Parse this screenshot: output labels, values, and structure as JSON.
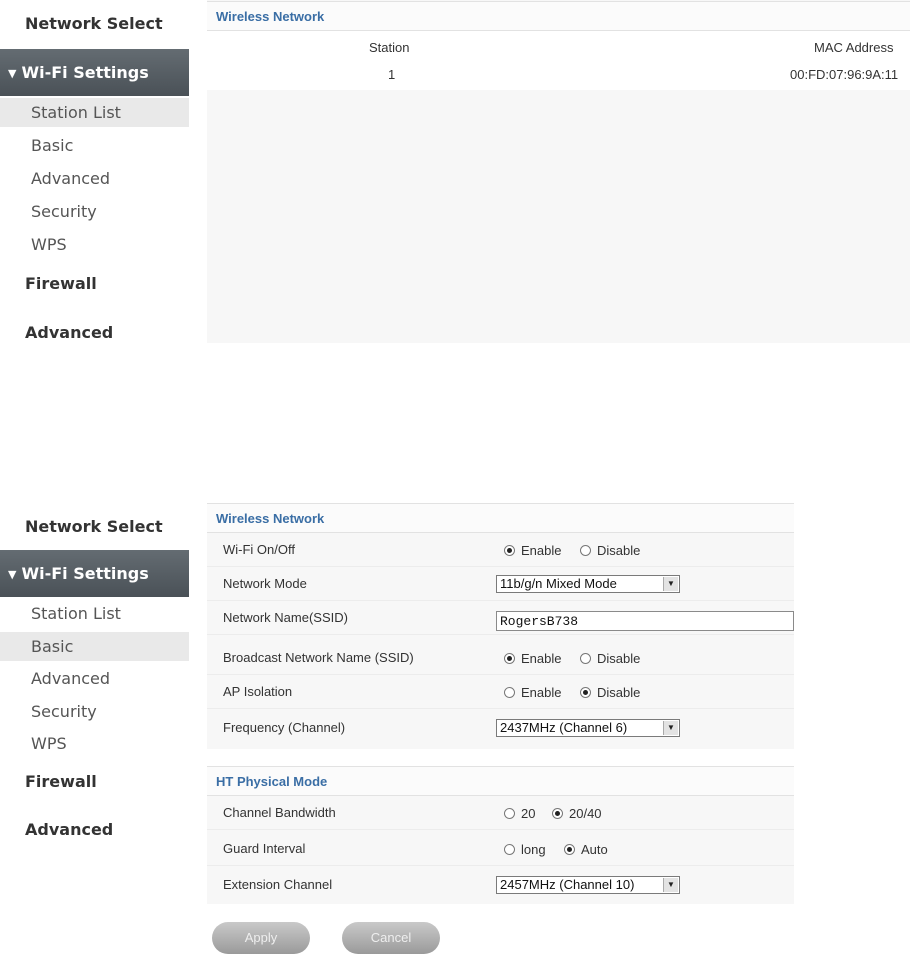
{
  "sidebar": {
    "network_select": "Network Select",
    "wifi_settings": "Wi-Fi Settings",
    "items": [
      "Station List",
      "Basic",
      "Advanced",
      "Security",
      "WPS"
    ],
    "firewall": "Firewall",
    "advanced": "Advanced"
  },
  "station_list": {
    "section_title": "Wireless Network",
    "headers": {
      "station": "Station",
      "mac": "MAC Address"
    },
    "rows": [
      {
        "station": "1",
        "mac": "00:FD:07:96:9A:11"
      }
    ]
  },
  "basic": {
    "section_title": "Wireless Network",
    "wifi_onoff_label": "Wi-Fi On/Off",
    "network_mode_label": "Network Mode",
    "network_mode_value": "11b/g/n Mixed Mode",
    "ssid_label": "Network Name(SSID)",
    "ssid_value": "RogersB738",
    "broadcast_label": "Broadcast Network Name (SSID)",
    "ap_isolation_label": "AP Isolation",
    "frequency_label": "Frequency (Channel)",
    "frequency_value": "2437MHz (Channel 6)",
    "enable": "Enable",
    "disable": "Disable"
  },
  "ht": {
    "section_title": "HT Physical Mode",
    "bandwidth_label": "Channel Bandwidth",
    "bw_20": "20",
    "bw_2040": "20/40",
    "guard_label": "Guard Interval",
    "guard_long": "long",
    "guard_auto": "Auto",
    "extension_label": "Extension Channel",
    "extension_value": "2457MHz (Channel 10)"
  },
  "buttons": {
    "apply": "Apply",
    "cancel": "Cancel"
  },
  "icons": {
    "expand": "triangle-down-icon",
    "dropdown": "dropdown-arrow-icon"
  }
}
